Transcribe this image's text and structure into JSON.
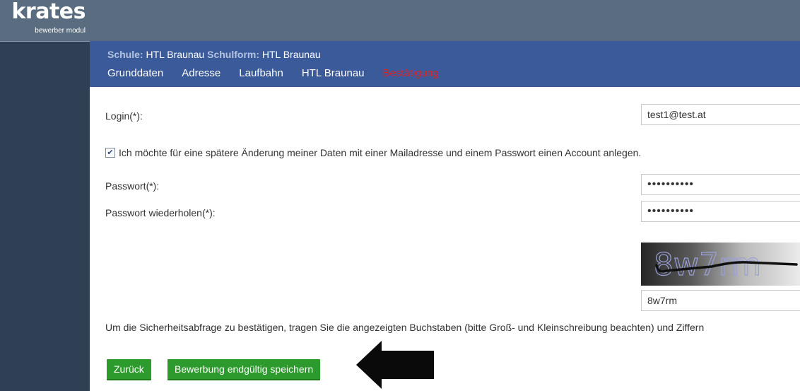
{
  "brand": {
    "logo": "krates",
    "subtitle": "bewerber modul"
  },
  "header": {
    "school_label": "Schule:",
    "school_value": "HTL Braunau",
    "form_label": "Schulform:",
    "form_value": "HTL Braunau",
    "tabs": [
      {
        "label": "Grunddaten"
      },
      {
        "label": "Adresse"
      },
      {
        "label": "Laufbahn"
      },
      {
        "label": "HTL Braunau"
      },
      {
        "label": "Bestätigung",
        "active": true
      }
    ]
  },
  "form": {
    "login_label": "Login(*):",
    "login_value": "test1@test.at",
    "account_checkbox_label": "Ich möchte für eine spätere Änderung meiner Daten mit einer Mailadresse und einem Passwort einen Account anlegen.",
    "account_checked": true,
    "password_label": "Passwort(*):",
    "password_value": "••••••••••",
    "password_repeat_label": "Passwort wiederholen(*):",
    "password_repeat_value": "••••••••••",
    "captcha_text": "8w7rm",
    "captcha_input_value": "8w7rm",
    "captcha_hint": "Um die Sicherheitsabfrage zu bestätigen, tragen Sie die angezeigten Buchstaben (bitte Groß- und Kleinschreibung beachten) und Ziffern"
  },
  "buttons": {
    "back_label": "Zurück",
    "save_label": "Bewerbung endgültig speichern"
  },
  "colors": {
    "sidebar": "#2f4054",
    "header": "#3a5a9a",
    "active_tab": "#e32222",
    "button": "#2d9a2d"
  }
}
